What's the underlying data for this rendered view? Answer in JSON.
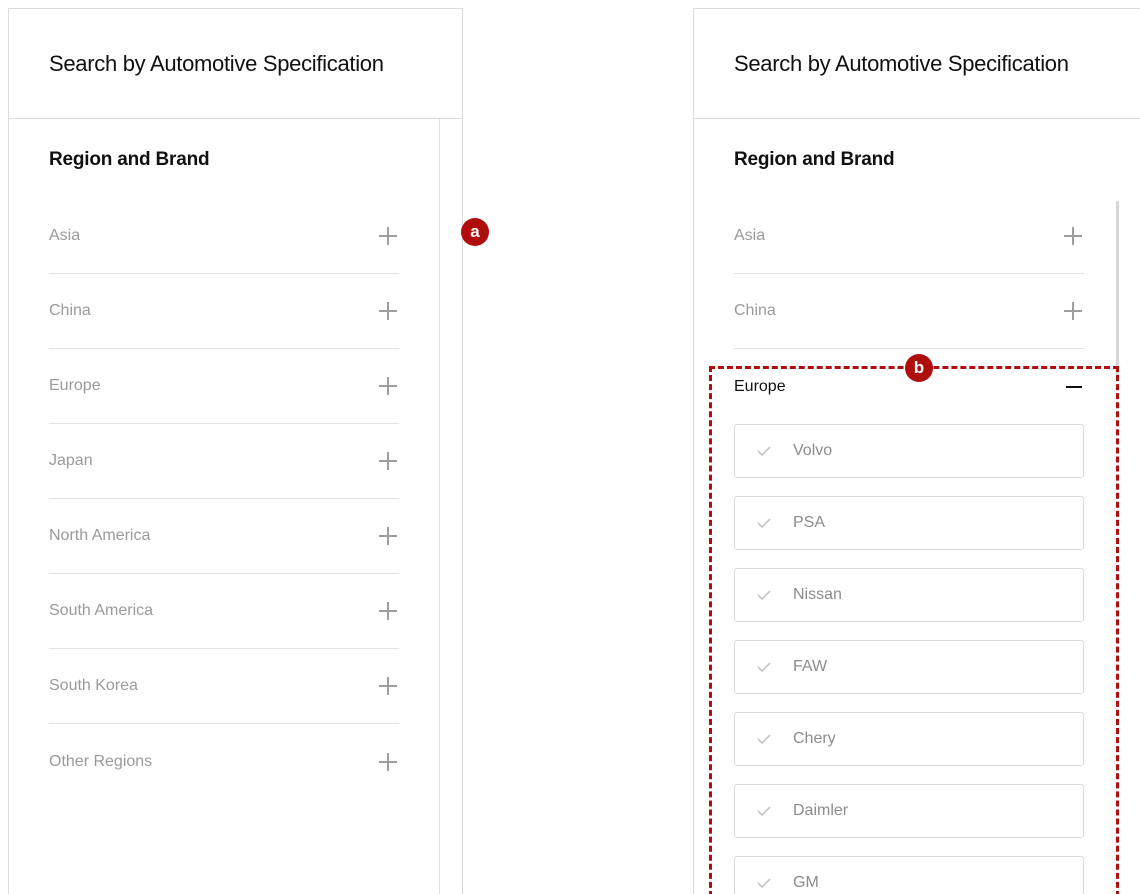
{
  "panel_a": {
    "title": "Search by Automotive Specification",
    "section_title": "Region and Brand",
    "regions": [
      {
        "label": "Asia"
      },
      {
        "label": "China"
      },
      {
        "label": "Europe"
      },
      {
        "label": "Japan"
      },
      {
        "label": "North America"
      },
      {
        "label": "South America"
      },
      {
        "label": "South Korea"
      },
      {
        "label": "Other Regions"
      }
    ]
  },
  "panel_b": {
    "title": "Search by Automotive Specification",
    "section_title": "Region and Brand",
    "regions": [
      {
        "label": "Asia"
      },
      {
        "label": "China"
      }
    ],
    "expanded_region": {
      "label": "Europe",
      "brands": [
        {
          "label": "Volvo"
        },
        {
          "label": "PSA"
        },
        {
          "label": "Nissan"
        },
        {
          "label": "FAW"
        },
        {
          "label": "Chery"
        },
        {
          "label": "Daimler"
        },
        {
          "label": "GM"
        }
      ]
    }
  },
  "markers": {
    "a": "a",
    "b": "b"
  },
  "colors": {
    "accent_marker": "#b00d0d",
    "inactive_text": "#9a9a9a",
    "border": "#dcdcdc"
  },
  "icons": {
    "collapsed": "plus-icon",
    "expanded": "minus-icon",
    "brand": "check-icon"
  }
}
